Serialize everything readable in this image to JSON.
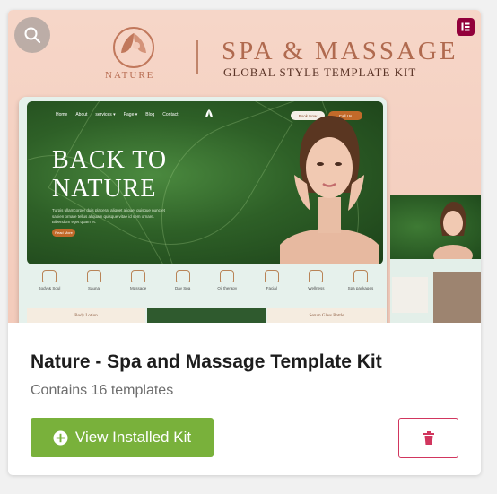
{
  "kit": {
    "name": "Nature - Spa and Massage Template Kit",
    "count_label": "Contains 16 templates",
    "view_button_label": "View Installed Kit"
  },
  "preview": {
    "logo_word": "NATURE",
    "title": "SPA & MASSAGE",
    "subtitle": "GLOBAL STYLE TEMPLATE KIT",
    "mock": {
      "nav": [
        "Home",
        "About",
        "services ▾",
        "Page ▾",
        "Blog",
        "Contact"
      ],
      "btn_book": "Book Now",
      "btn_call": "Call Us",
      "hero_title": "BACK TO NATURE",
      "hero_text": "Turpis ullamcorper duis placerat aliquet aliquet quisque nunc et sapien ornare tellus aliquam quisque vitae id sem ornare. Bibendum eget quam et.",
      "hero_btn": "Read More",
      "categories": [
        "Body & Soul",
        "Sauna",
        "Massage",
        "Day Spa",
        "Oil therapy",
        "Facial",
        "Wellness",
        "Spa packages"
      ],
      "products": [
        "Body Lotion",
        "",
        "Serum Glass Bottle"
      ]
    }
  },
  "icons": {
    "zoom": "search-icon",
    "brand": "elementor-icon",
    "view": "plus-circle-icon",
    "delete": "trash-icon"
  },
  "colors": {
    "primary_button": "#79b13b",
    "danger": "#d1365e",
    "elementor": "#92003b",
    "brand_accent": "#b06a4f"
  }
}
